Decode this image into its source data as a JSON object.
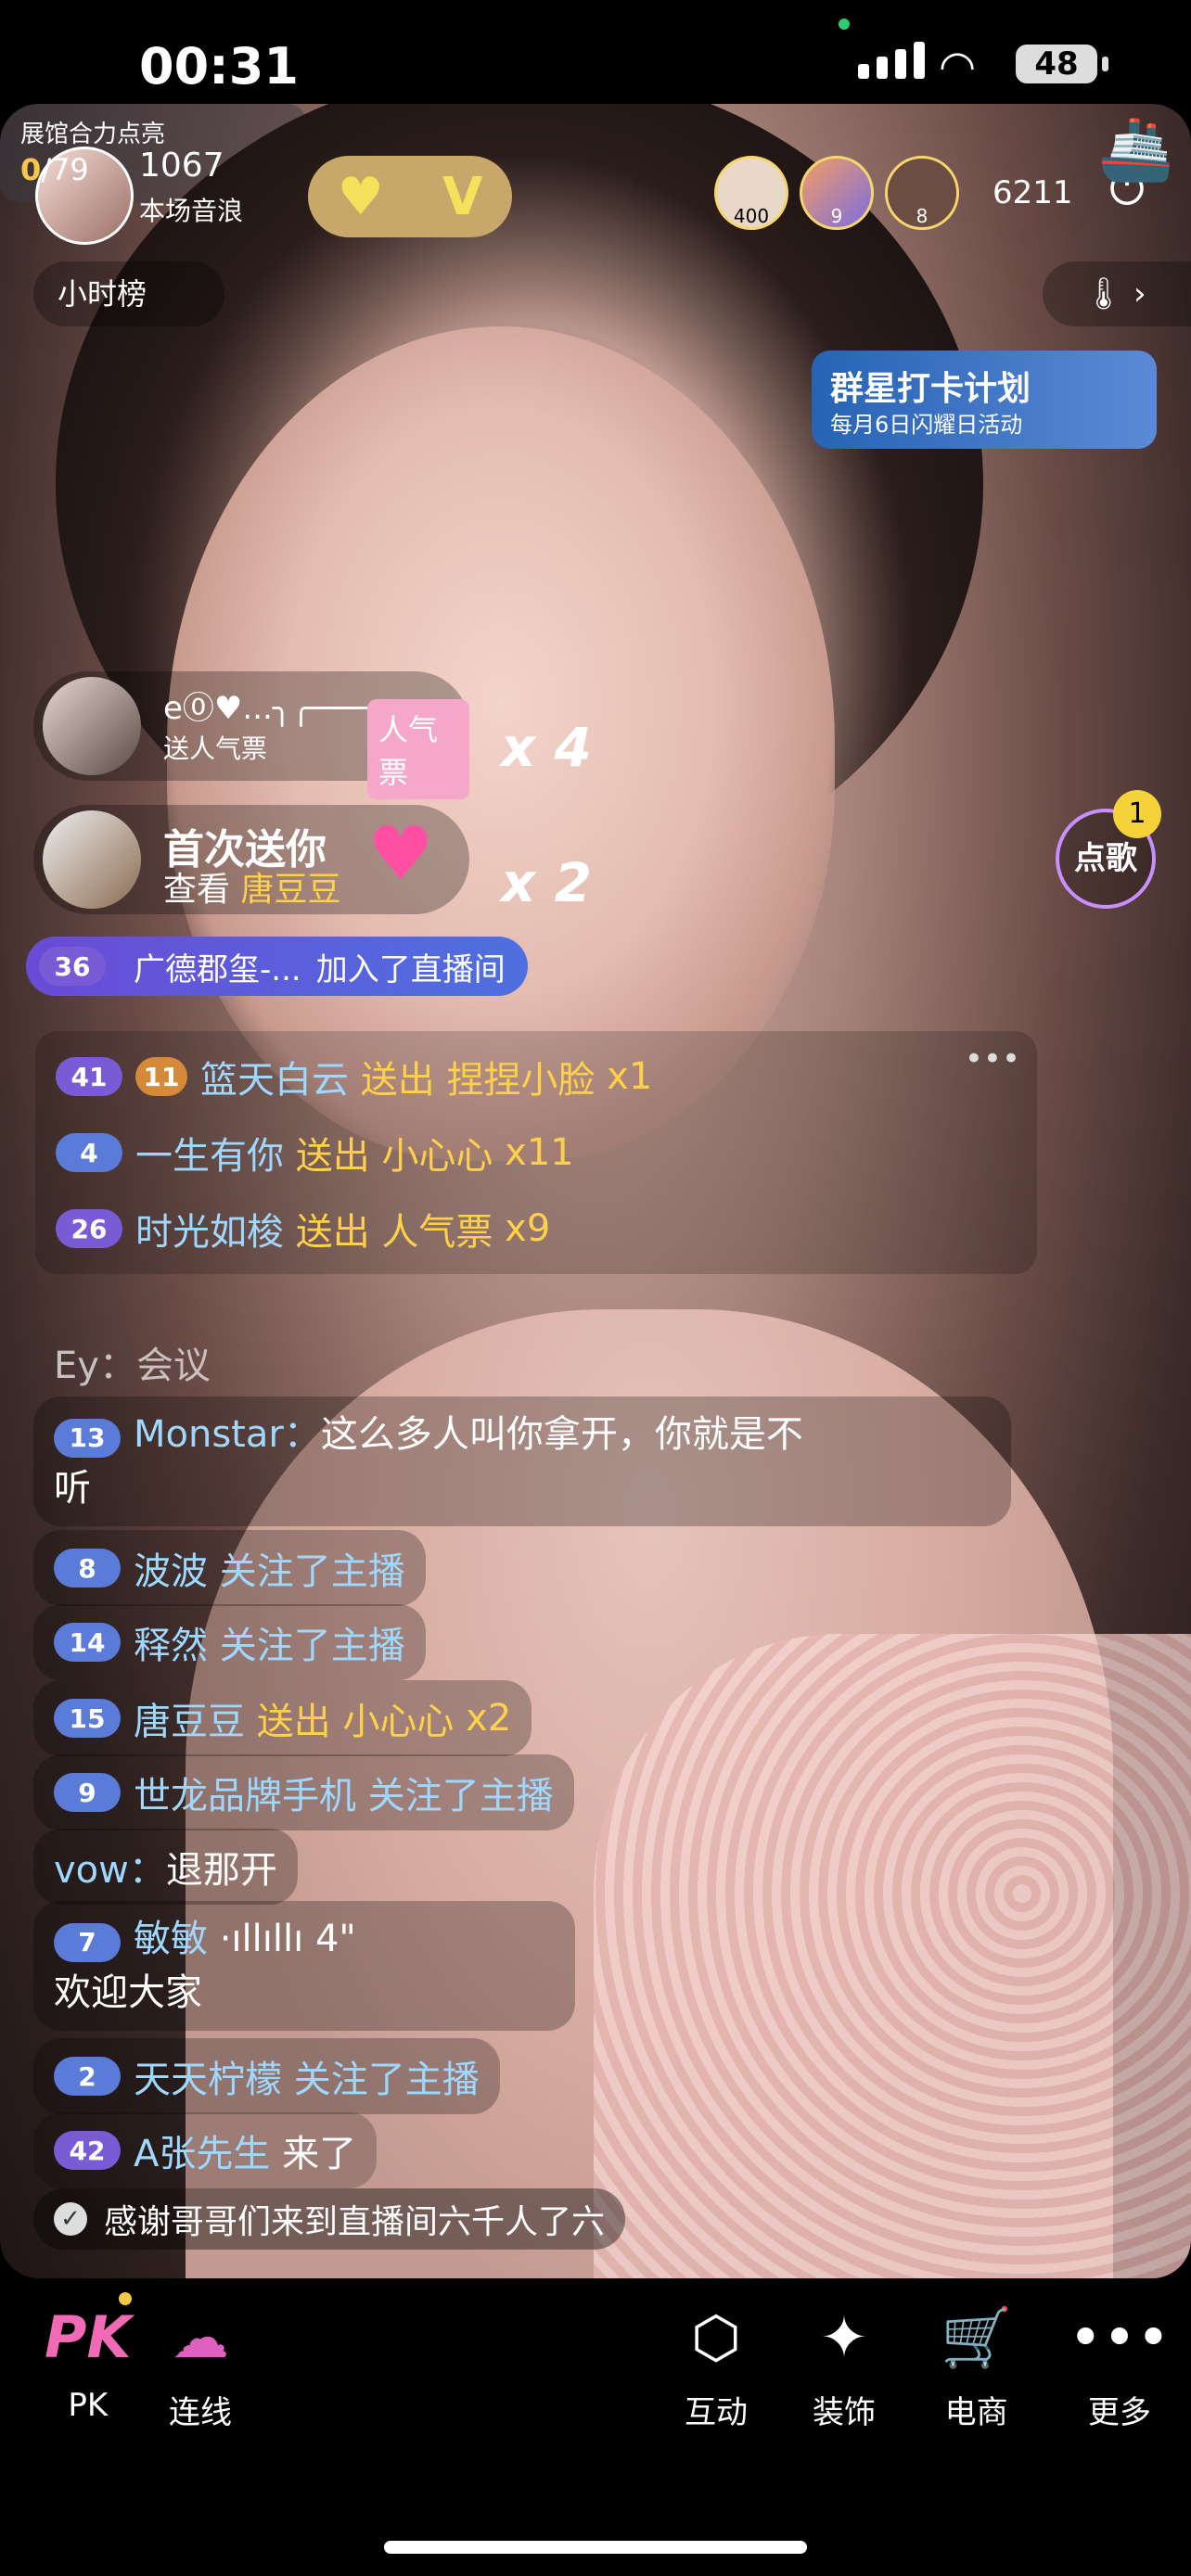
{
  "status": {
    "time": "00:31",
    "battery": "48"
  },
  "host": {
    "count": "1067",
    "subtitle": "本场音浪"
  },
  "viewers": {
    "badges": [
      "400",
      "9",
      "8"
    ],
    "count": "6211"
  },
  "hourly_rank": "小时榜",
  "exhibit": {
    "title": "展馆合力点亮",
    "progress_current": "0",
    "progress_total": "/79"
  },
  "star_event": {
    "title": "群星打卡计划",
    "sub": "每月6日闪耀日活动"
  },
  "gift_popups": [
    {
      "name": "e⓪♥...╮╭───",
      "sub": "送人气票",
      "icon": "人气票",
      "multiplier": "x 4"
    },
    {
      "name": "首次送你",
      "sub_prefix": "查看 ",
      "sub_user": "唐豆豆",
      "multiplier": "x 2"
    }
  ],
  "song": {
    "label": "点歌",
    "badge": "1"
  },
  "join": {
    "level": "36",
    "user": "广德郡玺-...",
    "action": "加入了直播间"
  },
  "gift_log": [
    {
      "level": "41",
      "badge2": "11",
      "user": "篮天白云",
      "action": "送出",
      "gift": "捏捏小脸",
      "qty": "x1"
    },
    {
      "level": "4",
      "user": "一生有你",
      "action": "送出",
      "gift": "小心心",
      "qty": "x11"
    },
    {
      "level": "26",
      "user": "时光如梭",
      "action": "送出",
      "gift": "人气票",
      "qty": "x9"
    }
  ],
  "chat": {
    "ey": {
      "user": "Ey：",
      "text": "会议"
    },
    "monstar": {
      "level": "13",
      "user": "Monstar：",
      "text1": "这么多人叫你拿开，你就是不",
      "text2": "听"
    },
    "bobo": {
      "level": "8",
      "user": "波波",
      "action": "关注了主播"
    },
    "shiran": {
      "level": "14",
      "user": "释然",
      "action": "关注了主播"
    },
    "tangdoudou": {
      "level": "15",
      "user": "唐豆豆",
      "action": "送出",
      "gift": "小心心",
      "qty": "x2"
    },
    "shilong": {
      "level": "9",
      "user": "世龙品牌手机",
      "action": "关注了主播"
    },
    "vow": {
      "user": "vow：",
      "text": "退那开"
    },
    "minmin": {
      "level": "7",
      "user": "敏敏",
      "voice": "·ıllıllı 4\"",
      "text": "欢迎大家"
    },
    "tianning": {
      "level": "2",
      "user": "天天柠檬",
      "action": "关注了主播"
    },
    "azhang": {
      "level": "42",
      "user": "A张先生",
      "action": "来了"
    }
  },
  "thanks": "感谢哥哥们来到直播间六千人了六",
  "tabs": [
    {
      "label": "PK"
    },
    {
      "label": "连线"
    },
    {
      "label": "互动"
    },
    {
      "label": "装饰"
    },
    {
      "label": "电商"
    },
    {
      "label": "更多"
    }
  ]
}
